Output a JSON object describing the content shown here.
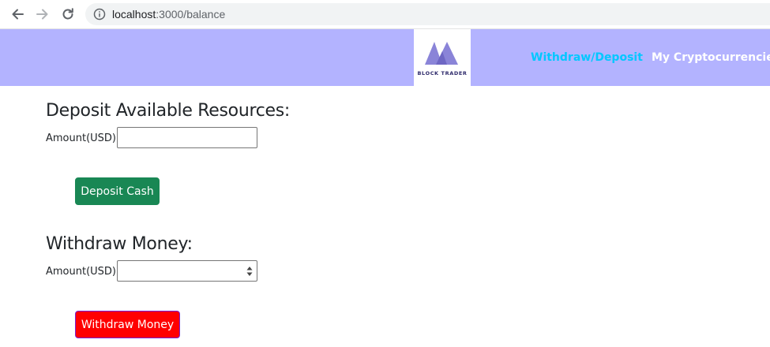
{
  "browser": {
    "url_host": "localhost",
    "url_path": ":3000/balance"
  },
  "navbar": {
    "brand_text": "BLOCK TRADER",
    "links": [
      {
        "label": "Withdraw/Deposit",
        "color": "#00c8ff"
      },
      {
        "label": "My Cryptocurrencies",
        "color": "#ffffff"
      }
    ],
    "background": "#b3b3ff"
  },
  "deposit": {
    "title": "Deposit Available Resources:",
    "amount_label": "Amount(USD):",
    "amount_value": "",
    "button_label": "Deposit Cash",
    "button_color": "#198754"
  },
  "withdraw": {
    "title": "Withdraw Money:",
    "amount_label": "Amount(USD):",
    "amount_value": "",
    "button_label": "Withdraw Money",
    "button_color": "#ff0000"
  }
}
